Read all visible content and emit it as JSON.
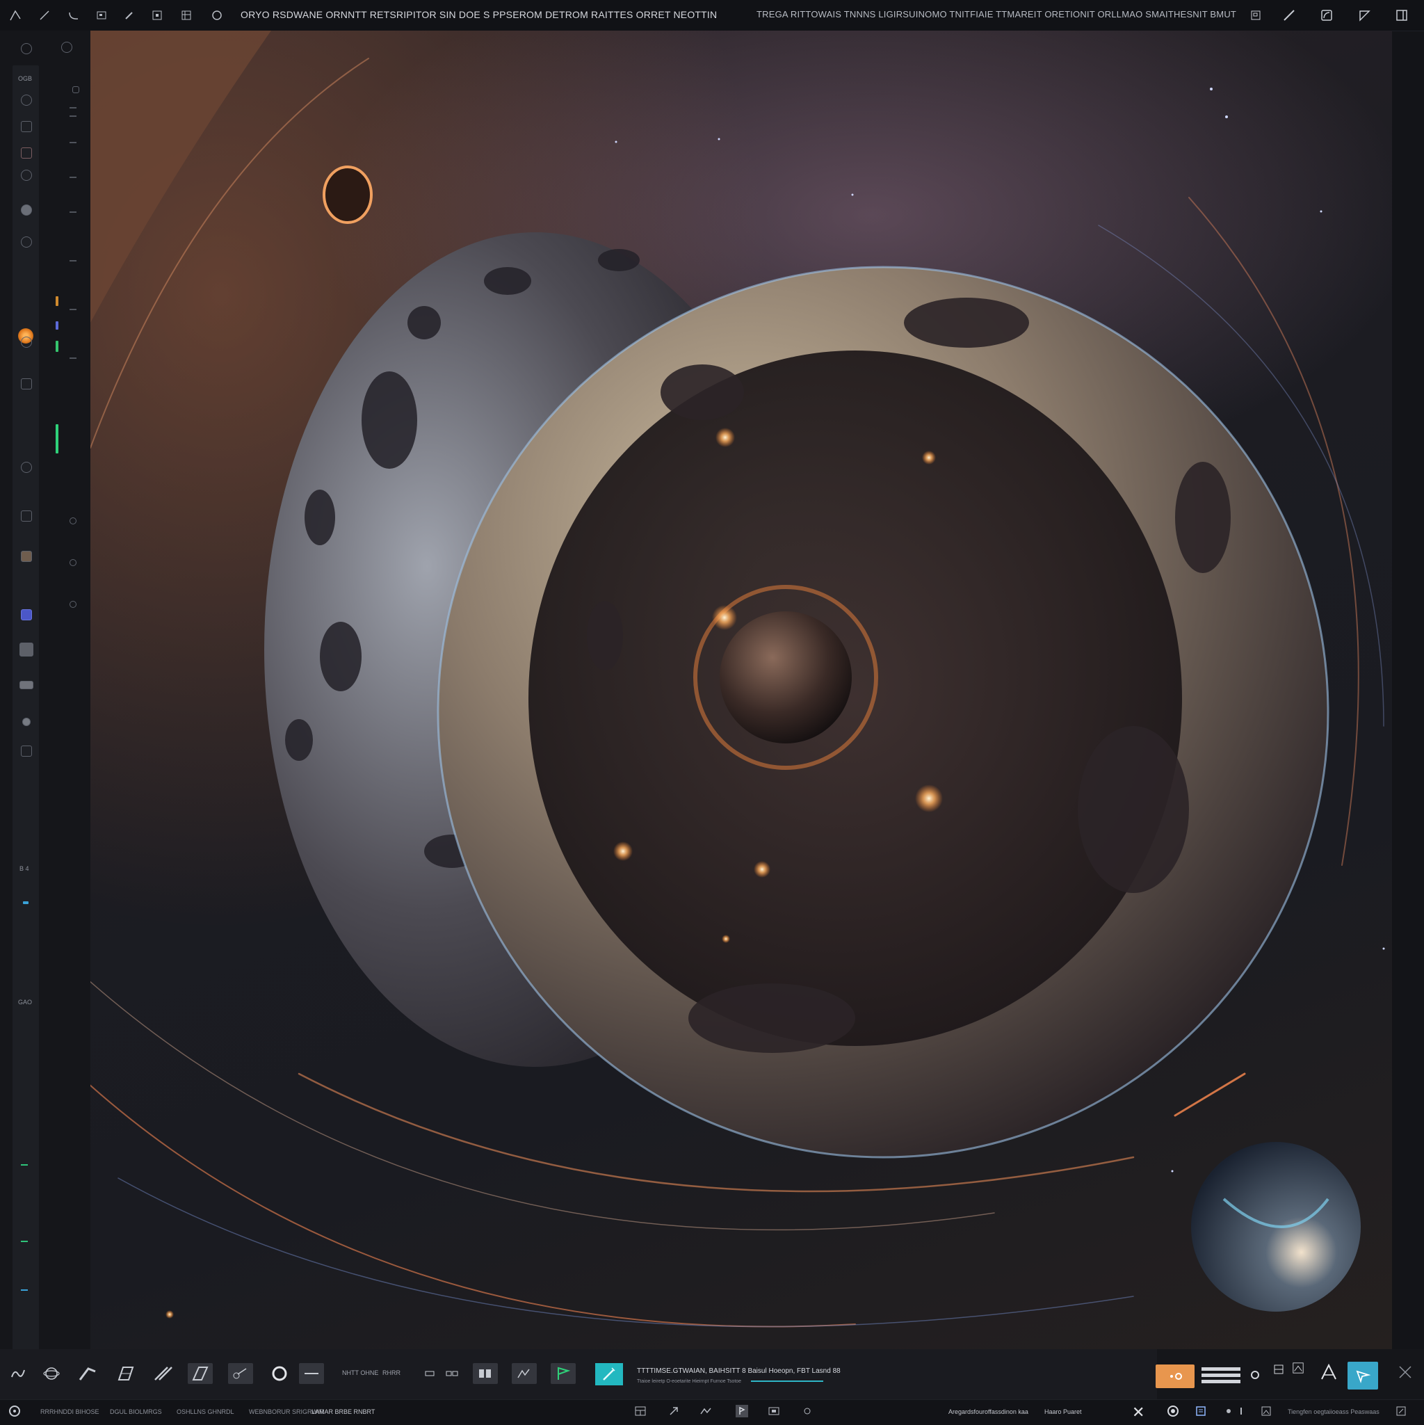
{
  "topbar": {
    "title_left": "ORYO RSDWANE ORNNTT RETSRIPITOR SIN DOE S PPSEROM  DETROM RAITTES  ORRET NEOTTIN",
    "title_right": "TREGA RITTOWAIS TNNNS  LIGIRSUINOMO TNITFIAIE TTMAREIT ORETIONIT ORLLMAO SMAITHESNIT BMUT",
    "left_icons": [
      "pen-icon",
      "line-icon",
      "curve-icon",
      "frame-icon",
      "brush-icon",
      "square-icon",
      "grid-icon",
      "circle-icon"
    ],
    "right_icons": [
      "panel-icon",
      "pencil-icon",
      "shape-icon",
      "triangle-icon",
      "sidebar-icon"
    ]
  },
  "left_rail": {
    "labels": [
      "OGB",
      "GAO",
      "B 4"
    ]
  },
  "bottom_toolbar": {
    "tools": [
      "scribble-icon",
      "orbit-icon",
      "arrow-tool-icon",
      "grid-tool-icon",
      "stroke-icon",
      "parallelogram-icon",
      "node-icon",
      "circle-tool-icon",
      "line-tool-icon"
    ],
    "small_labels": [
      "NHTT OHNE",
      "RHRR"
    ],
    "status_main": "TTTTIMSE.GTWAIAN, BAIHSITT 8 Baisul  Hoeopn, FBT Lasnd 88",
    "status_sub": "Ttaioe  leiretp O-eoetarite Hieirnpt  Furnoe Tsotoe"
  },
  "bottom_status": {
    "left_labels": [
      "RRRHNDDI  BIHOSE",
      "DGUL BIOLMRGS",
      "OSHLLNS  GHNRDL",
      "WEBNBORUR SRIGRWIR",
      "LAMAR  BRBE RNBRT"
    ],
    "right_field_1": "Aregardsfouroffassdinon kaa",
    "right_field_2": "Haaro Puaret",
    "right_label": "Tiengfen oegtaiioeass Peaswaas"
  },
  "colors": {
    "accent_orange": "#e8964e",
    "accent_teal": "#23b8c0",
    "accent_blue": "#39a7c9",
    "rail_orange": "#e07a1e"
  }
}
